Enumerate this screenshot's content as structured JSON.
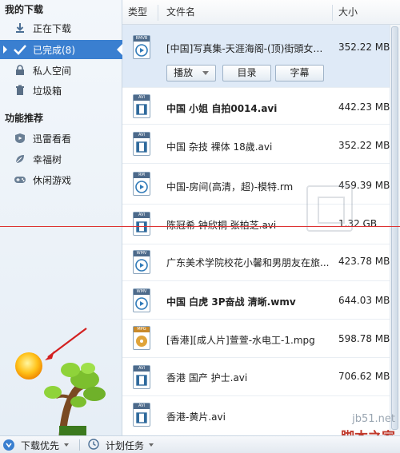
{
  "sidebar": {
    "section1_title": "我的下载",
    "items": [
      {
        "label": "正在下载",
        "icon": "download-icon",
        "active": false
      },
      {
        "label": "已完成(8)",
        "icon": "check-icon",
        "active": true
      },
      {
        "label": "私人空间",
        "icon": "lock-icon",
        "active": false
      },
      {
        "label": "垃圾箱",
        "icon": "trash-icon",
        "active": false
      }
    ],
    "section2_title": "功能推荐",
    "features": [
      {
        "label": "迅雷看看",
        "icon": "shield-play-icon"
      },
      {
        "label": "幸福树",
        "icon": "leaf-icon"
      },
      {
        "label": "休闲游戏",
        "icon": "gamepad-icon"
      }
    ]
  },
  "list": {
    "headers": {
      "type": "类型",
      "name": "文件名",
      "size": "大小"
    },
    "rows": [
      {
        "type": "RMVB",
        "name": "[中国]写真集-天涯海阁-(顶)街頭女孩(...",
        "size": "352.22 MB",
        "bold": false,
        "selected": true
      },
      {
        "type": "AVI",
        "name": "中国 小姐 自拍0014.avi",
        "size": "442.23 MB",
        "bold": true,
        "selected": false
      },
      {
        "type": "AVI",
        "name": "中国 杂技 裸体 18歲.avi",
        "size": "352.22 MB",
        "bold": false,
        "selected": false
      },
      {
        "type": "RM",
        "name": "中国-房间(高清，超)-模特.rm",
        "size": "459.39 MB",
        "bold": false,
        "selected": false
      },
      {
        "type": "AVI",
        "name": "陈冠希 钟欣桐 张柏芝.avi",
        "size": "1.32 GB",
        "bold": false,
        "selected": false
      },
      {
        "type": "WMV",
        "name": "广东美术学院校花小馨和男朋友在旅...",
        "size": "423.78 MB",
        "bold": false,
        "selected": false
      },
      {
        "type": "WMV",
        "name": "中国 白虎 3P奋战 清晰.wmv",
        "size": "644.03 MB",
        "bold": true,
        "selected": false
      },
      {
        "type": "MPG",
        "name": "[香港][成人片]萱萱-水电工-1.mpg",
        "size": "598.78 MB",
        "bold": false,
        "selected": false
      },
      {
        "type": "AVI",
        "name": "香港 国产 护士.avi",
        "size": "706.62 MB",
        "bold": false,
        "selected": false
      },
      {
        "type": "AVI",
        "name": "香港-黄片.avi",
        "size": "",
        "bold": false,
        "selected": false
      }
    ],
    "actions": {
      "play": "播放",
      "folder": "目录",
      "subtitle": "字幕"
    }
  },
  "bottombar": {
    "download_priority": "下载优先",
    "scheduled_tasks": "计划任务"
  },
  "watermark": {
    "site": "jb51.net",
    "brand": "脚本之家"
  },
  "colors": {
    "accent": "#3a7fd0",
    "selected_row": "#dfeaf7",
    "annotation_red": "#dd3333"
  }
}
